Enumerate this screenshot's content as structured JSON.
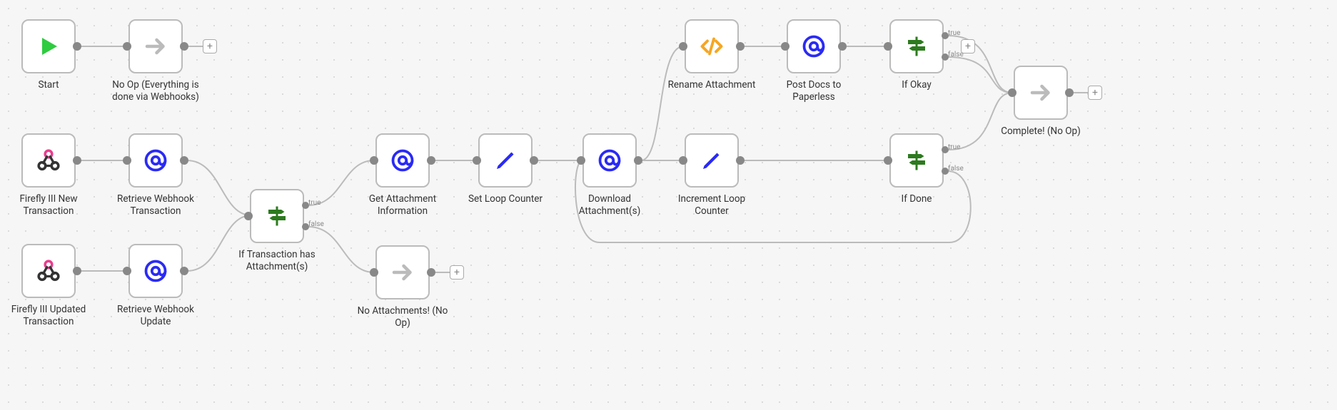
{
  "branchLabels": {
    "true": "true",
    "false": "false"
  },
  "plus": "+",
  "nodes": {
    "start": {
      "label": "Start"
    },
    "noop1": {
      "label": "No Op (Everything is done via Webhooks)"
    },
    "webhookNew": {
      "label": "Firefly III New Transaction"
    },
    "retrieveNew": {
      "label": "Retrieve Webhook Transaction"
    },
    "webhookUpd": {
      "label": "Firefly III Updated Transaction"
    },
    "retrieveUpd": {
      "label": "Retrieve Webhook Update"
    },
    "ifAttach": {
      "label": "If Transaction has Attachment(s)"
    },
    "getAttach": {
      "label": "Get Attachment Information"
    },
    "setLoop": {
      "label": "Set Loop Counter"
    },
    "noAttach": {
      "label": "No Attachments! (No Op)"
    },
    "download": {
      "label": "Download Attachment(s)"
    },
    "rename": {
      "label": "Rename Attachment"
    },
    "postDocs": {
      "label": "Post Docs to Paperless"
    },
    "ifOkay": {
      "label": "If Okay"
    },
    "incLoop": {
      "label": "Increment Loop Counter"
    },
    "ifDone": {
      "label": "If Done"
    },
    "complete": {
      "label": "Complete! (No Op)"
    }
  }
}
